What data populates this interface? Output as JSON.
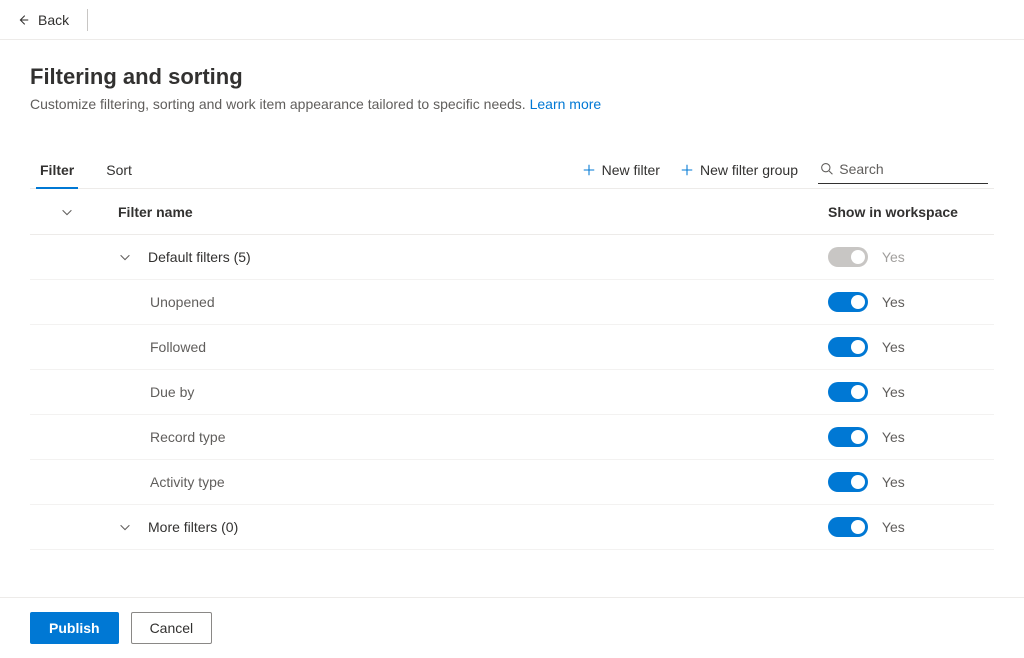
{
  "topbar": {
    "back_label": "Back"
  },
  "header": {
    "title": "Filtering and sorting",
    "description": "Customize filtering, sorting and work item appearance tailored to specific needs.",
    "learn_more": "Learn more"
  },
  "tabs": {
    "filter": "Filter",
    "sort": "Sort"
  },
  "actions": {
    "new_filter": "New filter",
    "new_filter_group": "New filter group",
    "search_placeholder": "Search"
  },
  "columns": {
    "name": "Filter name",
    "show": "Show in workspace"
  },
  "toggle_labels": {
    "yes": "Yes"
  },
  "groups": [
    {
      "label": "Default filters (5)",
      "enabled": false
    },
    {
      "label": "More filters (0)",
      "enabled": true
    }
  ],
  "default_filters": [
    {
      "label": "Unopened"
    },
    {
      "label": "Followed"
    },
    {
      "label": "Due by"
    },
    {
      "label": "Record type"
    },
    {
      "label": "Activity type"
    }
  ],
  "footer": {
    "publish": "Publish",
    "cancel": "Cancel"
  }
}
